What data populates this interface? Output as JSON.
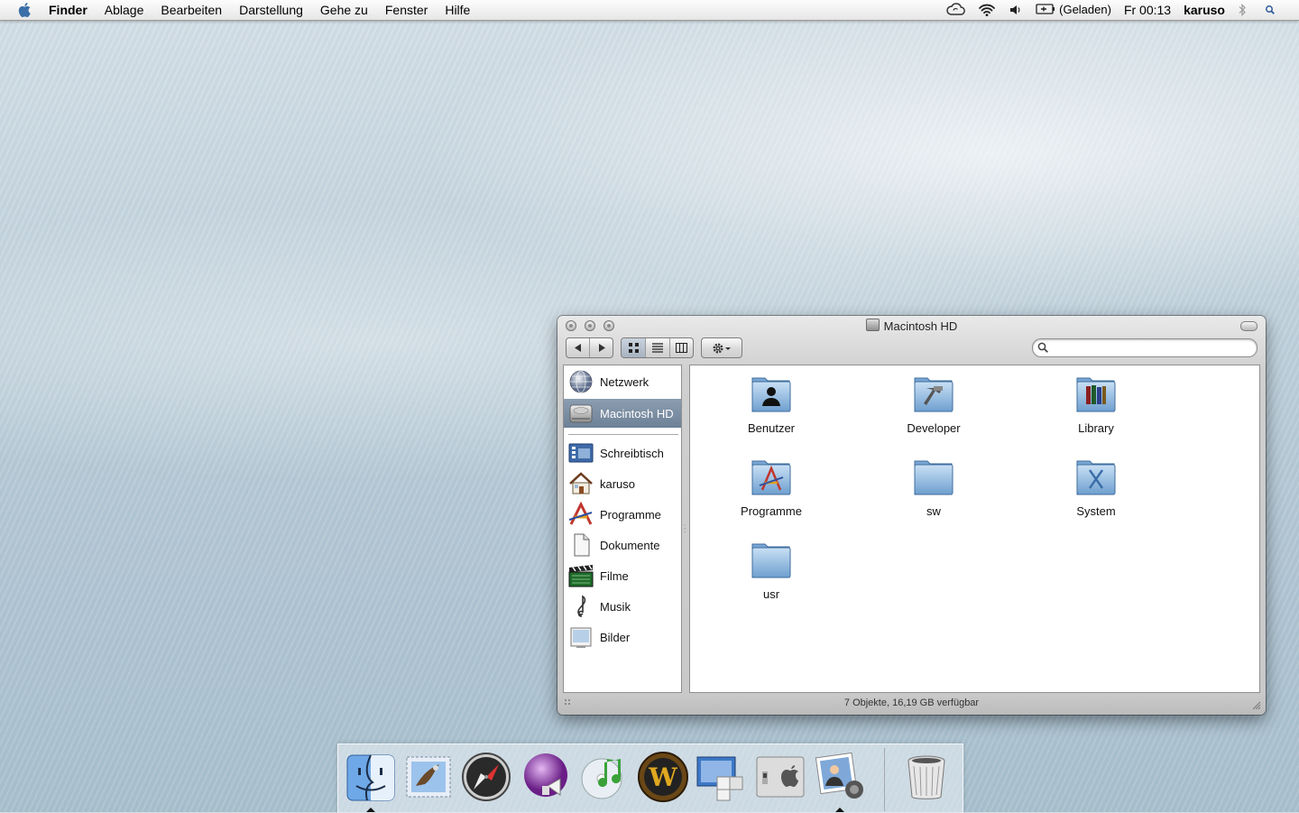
{
  "menubar": {
    "apple_icon": "apple-icon",
    "app_name": "Finder",
    "menus": [
      "Ablage",
      "Bearbeiten",
      "Darstellung",
      "Gehe zu",
      "Fenster",
      "Hilfe"
    ],
    "status": {
      "icons": [
        "mobileme-sync-icon",
        "wifi-icon",
        "volume-icon",
        "battery-icon",
        "bluetooth-icon",
        "spotlight-icon"
      ],
      "battery_text": "(Geladen)",
      "clock": "Fr 00:13",
      "user": "karuso"
    }
  },
  "window": {
    "title": "Macintosh HD",
    "search": {
      "placeholder": "",
      "value": ""
    },
    "view_mode": "icons",
    "sidebar": {
      "devices": [
        {
          "label": "Netzwerk",
          "icon": "network-globe-icon"
        },
        {
          "label": "Macintosh HD",
          "icon": "hard-disk-icon",
          "selected": true
        }
      ],
      "places": [
        {
          "label": "Schreibtisch",
          "icon": "desktop-icon"
        },
        {
          "label": "karuso",
          "icon": "home-icon"
        },
        {
          "label": "Programme",
          "icon": "applications-icon"
        },
        {
          "label": "Dokumente",
          "icon": "documents-icon"
        },
        {
          "label": "Filme",
          "icon": "movies-icon"
        },
        {
          "label": "Musik",
          "icon": "music-icon"
        },
        {
          "label": "Bilder",
          "icon": "pictures-icon"
        }
      ]
    },
    "items": [
      {
        "label": "Benutzer",
        "icon": "users-folder-icon"
      },
      {
        "label": "Developer",
        "icon": "developer-folder-icon"
      },
      {
        "label": "Library",
        "icon": "library-folder-icon"
      },
      {
        "label": "Programme",
        "icon": "applications-folder-icon"
      },
      {
        "label": "sw",
        "icon": "folder-icon"
      },
      {
        "label": "System",
        "icon": "system-folder-icon"
      },
      {
        "label": "usr",
        "icon": "folder-icon"
      }
    ],
    "status_text": "7 Objekte, 16,19 GB verfügbar"
  },
  "dock": {
    "apps": [
      "finder-icon",
      "mail-icon",
      "safari-icon",
      "ichat-icon",
      "itunes-icon",
      "world-of-warcraft-icon",
      "dashboard-icon",
      "system-preferences-icon",
      "iphoto-icon"
    ],
    "running": [
      "finder-icon",
      "iphoto-icon"
    ],
    "trash": "trash-icon"
  },
  "colors": {
    "selection": "#6d8197",
    "folder_blue": "#8fb8de"
  }
}
